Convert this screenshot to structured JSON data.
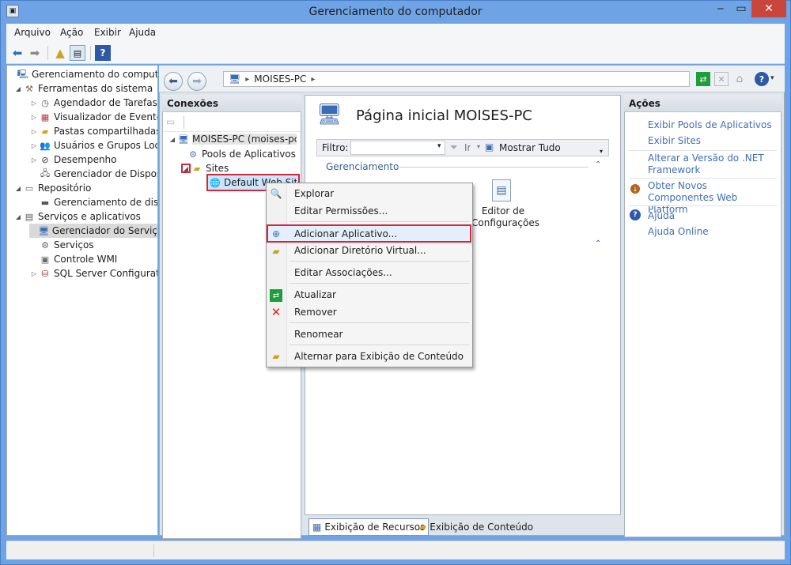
{
  "window": {
    "title": "Gerenciamento do computador"
  },
  "menu": [
    "Arquivo",
    "Ação",
    "Exibir",
    "Ajuda"
  ],
  "tree": [
    {
      "label": "Gerenciamento do computado",
      "icon": "computer-management-icon"
    },
    {
      "label": "Ferramentas do sistema",
      "icon": "tools-icon"
    },
    {
      "label": "Agendador de Tarefas",
      "icon": "clock-icon"
    },
    {
      "label": "Visualizador de Eventos",
      "icon": "event-viewer-icon"
    },
    {
      "label": "Pastas compartilhadas",
      "icon": "shared-folder-icon"
    },
    {
      "label": "Usuários e Grupos Loca",
      "icon": "users-icon"
    },
    {
      "label": "Desempenho",
      "icon": "performance-icon"
    },
    {
      "label": "Gerenciador de Disposit",
      "icon": "device-manager-icon"
    },
    {
      "label": "Repositório",
      "icon": "storage-icon"
    },
    {
      "label": "Gerenciamento de disco",
      "icon": "disk-icon"
    },
    {
      "label": "Serviços e aplicativos",
      "icon": "services-apps-icon"
    },
    {
      "label": "Gerenciador do Serviços",
      "icon": "iis-icon"
    },
    {
      "label": "Serviços",
      "icon": "services-icon"
    },
    {
      "label": "Controle WMI",
      "icon": "wmi-icon"
    },
    {
      "label": "SQL Server Configuratic",
      "icon": "sql-server-icon"
    }
  ],
  "address": {
    "path": "MOISES-PC",
    "separator": "▸"
  },
  "connections": {
    "header": "Conexões",
    "server": "MOISES-PC (moises-pc\\",
    "pools": "Pools de Aplicativos",
    "sites": "Sites",
    "default_site": "Default Web Site"
  },
  "center": {
    "title": "Página inicial MOISES-PC",
    "filter_label": "Filtro:",
    "go_label": "Ir",
    "show_all": "Mostrar Tudo",
    "group_label": "Gerenciamento",
    "feature_label": "Editor de Configurações"
  },
  "actions": {
    "header": "Ações",
    "items": [
      "Exibir Pools de Aplicativos",
      "Exibir Sites",
      "Alterar a Versão do .NET Framework",
      "Obter Novos Componentes Web Platform",
      "Ajuda",
      "Ajuda Online"
    ]
  },
  "tabs": {
    "features": "Exibição de Recursos",
    "content": "Exibição de Conteúdo"
  },
  "context_menu": [
    "Explorar",
    "Editar Permissões...",
    "Adicionar Aplicativo...",
    "Adicionar Diretório Virtual...",
    "Editar Associações...",
    "Atualizar",
    "Remover",
    "Renomear",
    "Alternar para Exibição de Conteúdo"
  ],
  "colors": {
    "accent": "#3f6fb5",
    "highlight": "#d2283c",
    "remove": "#d9281d",
    "refresh": "#1e9e3a"
  }
}
